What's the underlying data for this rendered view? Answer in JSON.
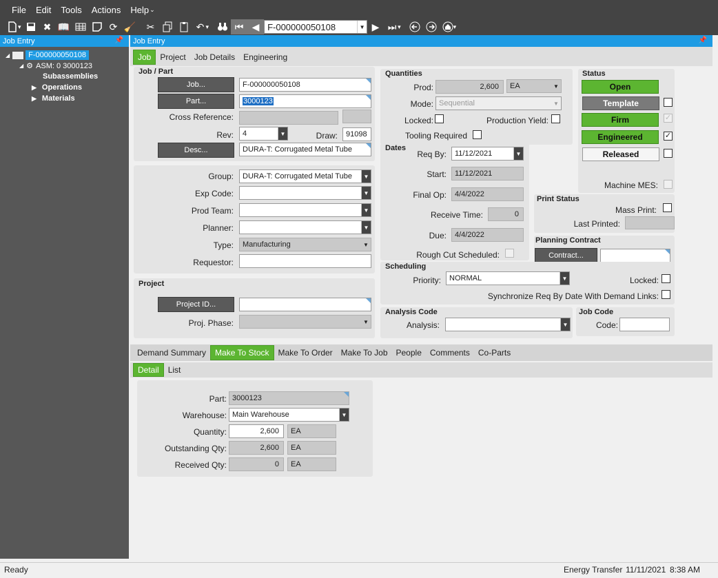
{
  "menu": {
    "file": "File",
    "edit": "Edit",
    "tools": "Tools",
    "actions": "Actions",
    "help": "Help"
  },
  "toolbar": {
    "nav_value": "F-000000050108"
  },
  "tree": {
    "title": "Job Entry",
    "root": "F-000000050108",
    "asm": "ASM: 0 3000123",
    "items": [
      "Subassemblies",
      "Operations",
      "Materials"
    ]
  },
  "main": {
    "title": "Job Entry",
    "tabs": [
      "Job",
      "Project",
      "Job Details",
      "Engineering"
    ]
  },
  "jobpart": {
    "title": "Job / Part",
    "job_btn": "Job...",
    "job_val": "F-000000050108",
    "part_btn": "Part...",
    "part_val": "3000123",
    "crossref_lbl": "Cross Reference:",
    "rev_lbl": "Rev:",
    "rev_val": "4",
    "draw_lbl": "Draw:",
    "draw_val": "91098",
    "desc_btn": "Desc...",
    "desc_val": "DURA-T: Corrugated Metal Tube"
  },
  "details": {
    "group_lbl": "Group:",
    "group_val": "DURA-T: Corrugated Metal Tube",
    "expcode_lbl": "Exp Code:",
    "prodteam_lbl": "Prod Team:",
    "planner_lbl": "Planner:",
    "type_lbl": "Type:",
    "type_val": "Manufacturing",
    "requestor_lbl": "Requestor:"
  },
  "project": {
    "title": "Project",
    "projid_btn": "Project ID...",
    "phase_lbl": "Proj. Phase:"
  },
  "quantities": {
    "title": "Quantities",
    "prod_lbl": "Prod:",
    "prod_val": "2,600",
    "prod_uom": "EA",
    "mode_lbl": "Mode:",
    "mode_val": "Sequential",
    "locked_lbl": "Locked:",
    "yield_lbl": "Production Yield:",
    "tooling_lbl": "Tooling Required"
  },
  "dates": {
    "title": "Dates",
    "reqby_lbl": "Req By:",
    "reqby_val": "11/12/2021",
    "start_lbl": "Start:",
    "start_val": "11/12/2021",
    "finalop_lbl": "Final Op:",
    "finalop_val": "4/4/2022",
    "receive_lbl": "Receive Time:",
    "receive_val": "0",
    "due_lbl": "Due:",
    "due_val": "4/4/2022",
    "roughcut_lbl": "Rough Cut Scheduled:"
  },
  "status": {
    "title": "Status",
    "open": "Open",
    "template": "Template",
    "firm": "Firm",
    "engineered": "Engineered",
    "released": "Released",
    "machine_lbl": "Machine MES:"
  },
  "print": {
    "title": "Print Status",
    "mass_lbl": "Mass Print:",
    "last_lbl": "Last Printed:"
  },
  "planning": {
    "title": "Planning Contract",
    "contract_btn": "Contract..."
  },
  "scheduling": {
    "title": "Scheduling",
    "priority_lbl": "Priority:",
    "priority_val": "NORMAL",
    "locked_lbl": "Locked:",
    "sync_lbl": "Synchronize Req By Date With Demand Links:"
  },
  "analysis": {
    "title": "Analysis Code",
    "lbl": "Analysis:"
  },
  "jobcode": {
    "title": "Job Code",
    "lbl": "Code:"
  },
  "lower_tabs": [
    "Demand Summary",
    "Make To Stock",
    "Make To Order",
    "Make To Job",
    "People",
    "Comments",
    "Co-Parts"
  ],
  "detail_tabs": [
    "Detail",
    "List"
  ],
  "mts": {
    "part_lbl": "Part:",
    "part_val": "3000123",
    "wh_lbl": "Warehouse:",
    "wh_val": "Main Warehouse",
    "qty_lbl": "Quantity:",
    "qty_val": "2,600",
    "qty_uom": "EA",
    "out_lbl": "Outstanding Qty:",
    "out_val": "2,600",
    "out_uom": "EA",
    "rec_lbl": "Received Qty:",
    "rec_val": "0",
    "rec_uom": "EA"
  },
  "statusbar": {
    "ready": "Ready",
    "company": "Energy Transfer",
    "date": "11/11/2021",
    "time": "8:38 AM"
  },
  "colors": {
    "accent": "#1e9be3",
    "green": "#5cb531",
    "dark": "#444444"
  }
}
